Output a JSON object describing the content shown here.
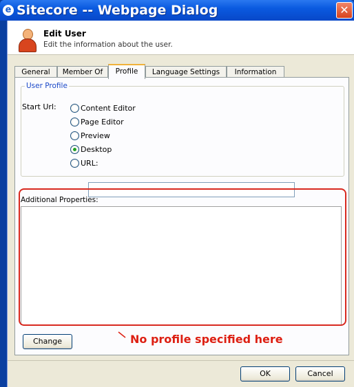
{
  "window": {
    "title": "Sitecore -- Webpage Dialog",
    "title_icon": "e",
    "close_glyph": "✕"
  },
  "header": {
    "title": "Edit User",
    "subtitle": "Edit the information about the user."
  },
  "tabs": [
    {
      "label": "General",
      "active": false
    },
    {
      "label": "Member Of",
      "active": false
    },
    {
      "label": "Profile",
      "active": true
    },
    {
      "label": "Language Settings",
      "active": false
    },
    {
      "label": "Information",
      "active": false
    }
  ],
  "user_profile": {
    "legend": "User Profile",
    "start_url_label": "Start Url:",
    "options": [
      {
        "label": "Content Editor",
        "checked": false
      },
      {
        "label": "Page Editor",
        "checked": false
      },
      {
        "label": "Preview",
        "checked": false
      },
      {
        "label": "Desktop",
        "checked": true
      },
      {
        "label": "URL:",
        "checked": false
      }
    ],
    "url_value": ""
  },
  "additional_properties": {
    "label": "Additional Properties:",
    "value": ""
  },
  "buttons": {
    "change": "Change",
    "ok": "OK",
    "cancel": "Cancel"
  },
  "annotation": {
    "text": "No profile specified here",
    "color": "#dd1f12"
  }
}
